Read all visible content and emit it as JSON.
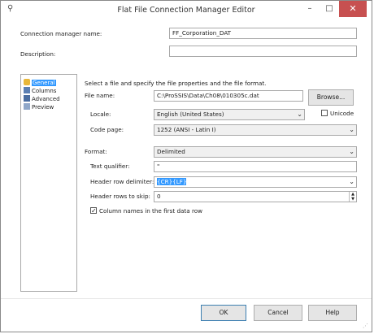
{
  "window": {
    "title": "Flat File Connection Manager Editor",
    "minimize": "–",
    "maximize": "□",
    "close": "✕"
  },
  "top": {
    "conn_name_label": "Connection manager name:",
    "conn_name_value": "FF_Corporation_DAT",
    "description_label": "Description:",
    "description_value": ""
  },
  "nav": {
    "items": [
      {
        "label": "General",
        "icon": "general-icon"
      },
      {
        "label": "Columns",
        "icon": "columns-icon"
      },
      {
        "label": "Advanced",
        "icon": "advanced-icon"
      },
      {
        "label": "Preview",
        "icon": "preview-icon"
      }
    ]
  },
  "general": {
    "instruction": "Select a file and specify the file properties and the file format.",
    "file_name_label": "File name:",
    "file_name_value": "C:\\ProSSIS\\Data\\Ch08\\010305c.dat",
    "browse_label": "Browse...",
    "locale_label": "Locale:",
    "locale_value": "English (United States)",
    "unicode_label": "Unicode",
    "codepage_label": "Code page:",
    "codepage_value": "1252 (ANSI - Latin I)",
    "format_label": "Format:",
    "format_value": "Delimited",
    "text_qualifier_label": "Text qualifier:",
    "text_qualifier_value": "\"",
    "header_delim_label": "Header row delimiter:",
    "header_delim_value": "{CR}{LF}",
    "header_skip_label": "Header rows to skip:",
    "header_skip_value": "0",
    "colnames_label": "Column names in the first data row",
    "colnames_checked": true
  },
  "buttons": {
    "ok": "OK",
    "cancel": "Cancel",
    "help": "Help"
  }
}
